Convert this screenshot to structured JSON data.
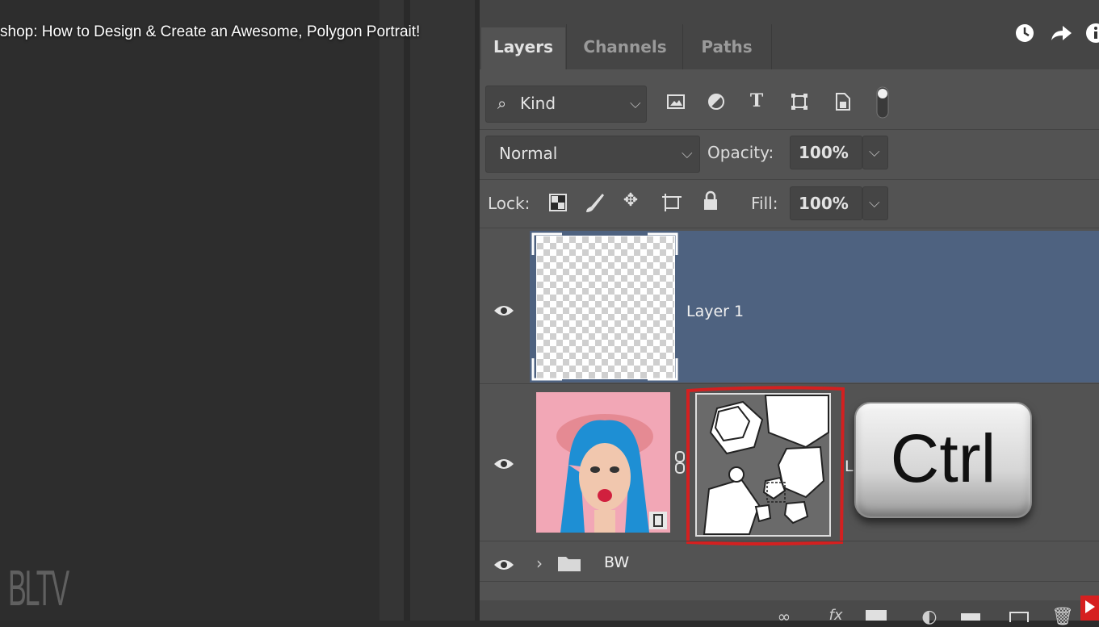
{
  "video": {
    "title": "shop: How to Design & Create an Awesome, Polygon Portrait!",
    "watermark": "BLTV",
    "controls": [
      "clock-icon",
      "share-icon",
      "info-icon"
    ]
  },
  "panel": {
    "tabs": [
      {
        "label": "Layers",
        "active": true
      },
      {
        "label": "Channels",
        "active": false
      },
      {
        "label": "Paths",
        "active": false
      }
    ],
    "filter": {
      "label": "Kind",
      "icons": [
        "image-filter-icon",
        "adjustment-filter-icon",
        "type-filter-icon",
        "shape-filter-icon",
        "smart-object-filter-icon",
        "filter-toggle-icon"
      ]
    },
    "blend_mode": "Normal",
    "opacity_label": "Opacity:",
    "opacity_value": "100%",
    "lock_label": "Lock:",
    "lock_icons": [
      "lock-transparent-icon",
      "lock-pixels-icon",
      "lock-position-icon",
      "lock-artboard-icon",
      "lock-all-icon"
    ],
    "fill_label": "Fill:",
    "fill_value": "100%",
    "layers": [
      {
        "name": "Layer 1",
        "selected": true,
        "visible": true
      },
      {
        "name": "L",
        "selected": false,
        "visible": true,
        "has_mask": true
      },
      {
        "name": "BW",
        "selected": false,
        "visible": true,
        "type": "group"
      }
    ]
  },
  "overlay": {
    "key_label": "Ctrl"
  },
  "colors": {
    "selection": "#4e6280",
    "panel": "#535353",
    "highlight": "#e02020"
  }
}
